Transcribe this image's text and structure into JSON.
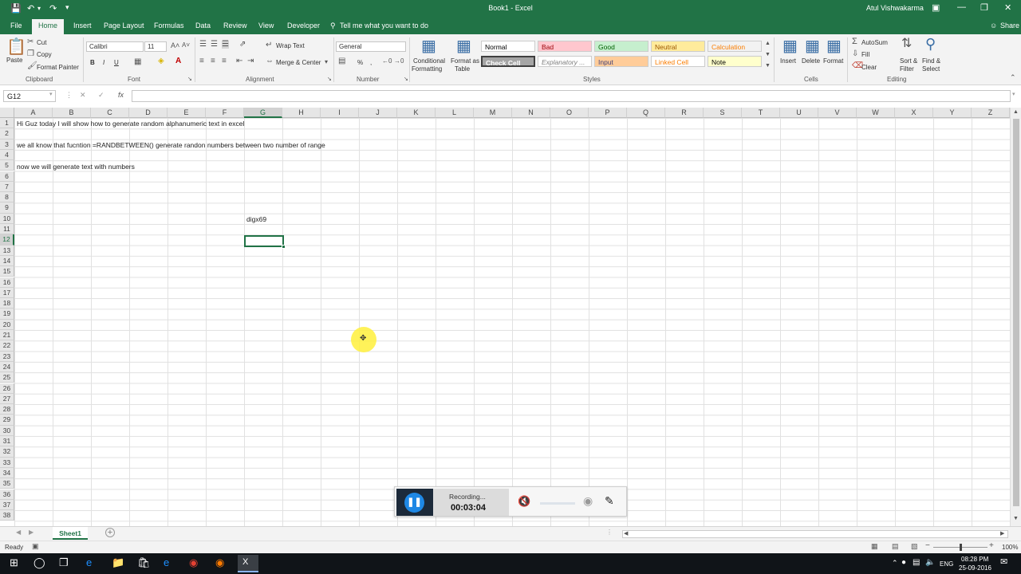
{
  "app": {
    "title": "Book1 - Excel",
    "user": "Atul Vishwakarma"
  },
  "quick_access": {
    "save": "save-icon",
    "undo": "undo-icon",
    "redo": "redo-icon",
    "customize": "customize-icon"
  },
  "window_controls": {
    "ribbon_options": "ribbon-display-icon",
    "minimize": "minimize-icon",
    "restore": "restore-icon",
    "close": "close-icon"
  },
  "tabs": [
    {
      "label": "File"
    },
    {
      "label": "Home"
    },
    {
      "label": "Insert"
    },
    {
      "label": "Page Layout"
    },
    {
      "label": "Formulas"
    },
    {
      "label": "Data"
    },
    {
      "label": "Review"
    },
    {
      "label": "View"
    },
    {
      "label": "Developer"
    }
  ],
  "active_tab": "Home",
  "tell_me": "Tell me what you want to do",
  "share": "Share",
  "ribbon": {
    "clipboard": {
      "paste": "Paste",
      "cut": "Cut",
      "copy": "Copy",
      "format_painter": "Format Painter",
      "group": "Clipboard"
    },
    "font": {
      "name": "Calibri",
      "size": "11",
      "bold": "B",
      "italic": "I",
      "underline": "U",
      "group": "Font"
    },
    "alignment": {
      "wrap": "Wrap Text",
      "merge": "Merge & Center",
      "group": "Alignment"
    },
    "number": {
      "format": "General",
      "percent": "%",
      "comma": ",",
      "group": "Number"
    },
    "conditional": {
      "line1": "Conditional",
      "line2": "Formatting"
    },
    "format_table": {
      "line1": "Format as",
      "line2": "Table"
    },
    "styles": {
      "group": "Styles",
      "items": [
        {
          "label": "Normal",
          "bg": "#ffffff",
          "fg": "#000000"
        },
        {
          "label": "Bad",
          "bg": "#ffc7ce",
          "fg": "#9c0006"
        },
        {
          "label": "Good",
          "bg": "#c6efce",
          "fg": "#006100"
        },
        {
          "label": "Neutral",
          "bg": "#ffeb9c",
          "fg": "#9c5700"
        },
        {
          "label": "Calculation",
          "bg": "#f2f2f2",
          "fg": "#fa7d00"
        },
        {
          "label": "Check Cell",
          "bg": "#a5a5a5",
          "fg": "#ffffff"
        },
        {
          "label": "Explanatory ...",
          "bg": "#ffffff",
          "fg": "#7f7f7f"
        },
        {
          "label": "Input",
          "bg": "#ffcc99",
          "fg": "#3f3f76"
        },
        {
          "label": "Linked Cell",
          "bg": "#ffffff",
          "fg": "#fa7d00"
        },
        {
          "label": "Note",
          "bg": "#ffffcc",
          "fg": "#000000"
        }
      ]
    },
    "cells": {
      "insert": "Insert",
      "delete": "Delete",
      "format": "Format",
      "group": "Cells"
    },
    "editing": {
      "autosum": "AutoSum",
      "fill": "Fill",
      "clear": "Clear",
      "sort_filter_1": "Sort &",
      "sort_filter_2": "Filter",
      "find_1": "Find &",
      "find_2": "Select",
      "group": "Editing"
    }
  },
  "formula_bar": {
    "name_box": "G12",
    "cancel": "✕",
    "enter": "✓",
    "fx": "fx",
    "value": ""
  },
  "columns": [
    "A",
    "B",
    "C",
    "D",
    "E",
    "F",
    "G",
    "H",
    "I",
    "J",
    "K",
    "L",
    "M",
    "N",
    "O",
    "P",
    "Q",
    "R",
    "S",
    "T",
    "U",
    "V",
    "W",
    "X",
    "Y",
    "Z"
  ],
  "rows": [
    "1",
    "2",
    "3",
    "4",
    "5",
    "6",
    "7",
    "8",
    "9",
    "10",
    "11",
    "12",
    "13",
    "14",
    "15",
    "16",
    "17",
    "18",
    "19",
    "20",
    "21",
    "22",
    "23",
    "24",
    "25",
    "26",
    "27",
    "28",
    "29",
    "30",
    "31",
    "32",
    "33",
    "34",
    "35",
    "36",
    "37",
    "38"
  ],
  "cells": {
    "A1": "Hi Guz today I will show how to generate random alphanumeric text in excel",
    "A3": "we all know that fucntion =RANDBETWEEN() generate randon numbers between two number of range",
    "A5": "now we will generate text with numbers",
    "G10": "digx69"
  },
  "selected_cell": "G12",
  "sheet": {
    "name": "Sheet1",
    "add": "+"
  },
  "status": {
    "ready": "Ready",
    "zoom": "100%"
  },
  "recorder": {
    "label": "Recording...",
    "time": "00:03:04"
  },
  "taskbar": {
    "lang": "ENG",
    "time": "08:28 PM",
    "date": "25-09-2016"
  }
}
